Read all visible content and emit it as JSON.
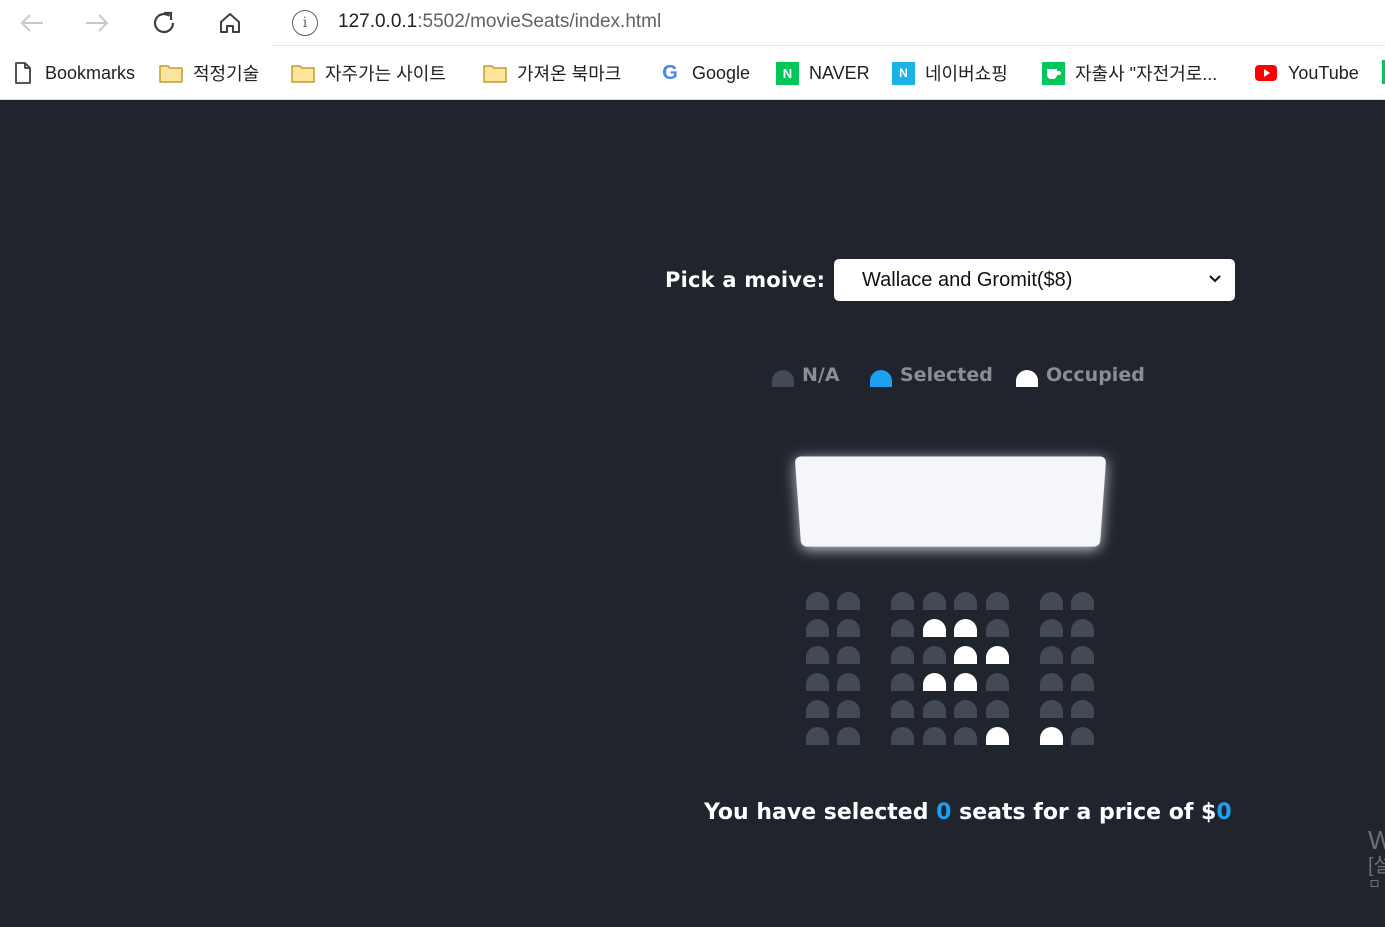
{
  "browser": {
    "url_host": "127.0.0.1",
    "url_path": ":5502/movieSeats/index.html",
    "info_glyph": "i",
    "bookmarks": [
      {
        "label": "Bookmarks",
        "icon": "page-icon"
      },
      {
        "label": "적정기술",
        "icon": "folder-icon"
      },
      {
        "label": "자주가는 사이트",
        "icon": "folder-icon"
      },
      {
        "label": "가져온 북마크",
        "icon": "folder-icon"
      },
      {
        "label": "Google",
        "icon": "google-icon",
        "glyph": "G"
      },
      {
        "label": "NAVER",
        "icon": "naver-icon",
        "glyph": "N"
      },
      {
        "label": "네이버쇼핑",
        "icon": "naver-shopping-icon",
        "glyph": "N"
      },
      {
        "label": "자출사 \"자전거로...",
        "icon": "cafe-icon"
      },
      {
        "label": "YouTube",
        "icon": "youtube-icon"
      }
    ]
  },
  "movie": {
    "label": "Pick a moive:",
    "selected": "Wallace and Gromit($8)"
  },
  "legend": {
    "na": "N/A",
    "selected": "Selected",
    "occupied": "Occupied"
  },
  "seat_rows": [
    [
      "na",
      "na",
      "na",
      "na",
      "na",
      "na",
      "na",
      "na"
    ],
    [
      "na",
      "na",
      "na",
      "occupied",
      "occupied",
      "na",
      "na",
      "na"
    ],
    [
      "na",
      "na",
      "na",
      "na",
      "occupied",
      "occupied",
      "na",
      "na"
    ],
    [
      "na",
      "na",
      "na",
      "occupied",
      "occupied",
      "na",
      "na",
      "na"
    ],
    [
      "na",
      "na",
      "na",
      "na",
      "na",
      "na",
      "na",
      "na"
    ],
    [
      "na",
      "na",
      "na",
      "na",
      "na",
      "occupied",
      "occupied",
      "na"
    ]
  ],
  "summary": {
    "prefix": "You have selected ",
    "count": "0",
    "middle": " seats for a price of $",
    "total": "0"
  },
  "watermark": {
    "line1": "W",
    "line2": "[설",
    "line3": "ㅁ"
  },
  "colors": {
    "background": "#1f242d",
    "seat_na": "#434955",
    "seat_selected": "#1ea0f0",
    "seat_occupied": "#ffffff",
    "highlight": "#1ea0f0"
  }
}
